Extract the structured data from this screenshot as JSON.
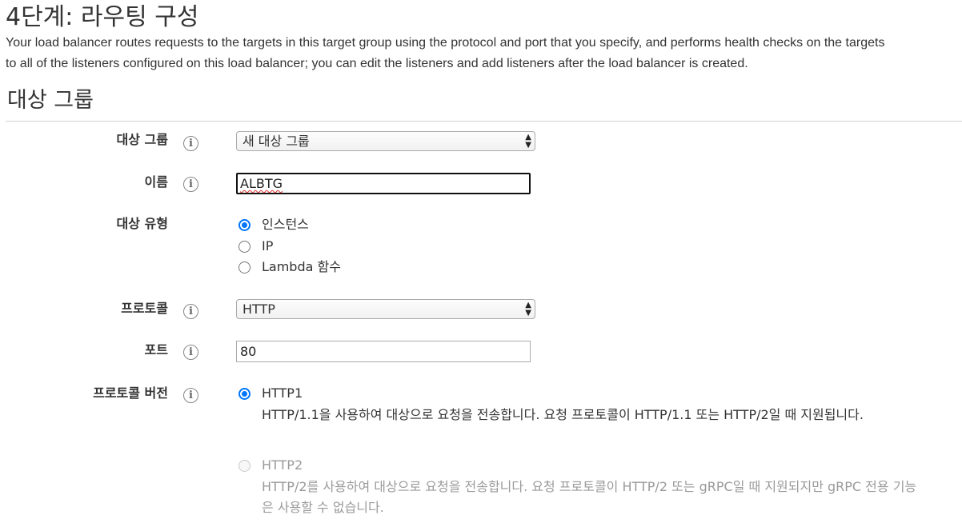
{
  "page": {
    "title": "4단계: 라우팅 구성",
    "description_line1": "Your load balancer routes requests to the targets in this target group using the protocol and port that you specify, and performs health checks on the targets",
    "description_line2": "to all of the listeners configured on this load balancer; you can edit the listeners and add listeners after the load balancer is created."
  },
  "section": {
    "title": "대상 그룹"
  },
  "form": {
    "target_group": {
      "label": "대상 그룹",
      "value": "새 대상 그룹"
    },
    "name": {
      "label": "이름",
      "value": "ALBTG"
    },
    "target_type": {
      "label": "대상 유형",
      "options": [
        {
          "label": "인스턴스",
          "checked": true
        },
        {
          "label": "IP",
          "checked": false
        },
        {
          "label": "Lambda 함수",
          "checked": false
        }
      ]
    },
    "protocol": {
      "label": "프로토콜",
      "value": "HTTP"
    },
    "port": {
      "label": "포트",
      "value": "80"
    },
    "protocol_version": {
      "label": "프로토콜 버전",
      "options": [
        {
          "label": "HTTP1",
          "checked": true,
          "enabled": true,
          "description": "HTTP/1.1을 사용하여 대상으로 요청을 전송합니다. 요청 프로토콜이 HTTP/1.1 또는 HTTP/2일 때 지원됩니다."
        },
        {
          "label": "HTTP2",
          "checked": false,
          "enabled": false,
          "description": "HTTP/2를 사용하여 대상으로 요청을 전송합니다. 요청 프로토콜이 HTTP/2 또는 gRPC일 때 지원되지만 gRPC 전용 기능은 사용할 수 없습니다."
        }
      ]
    }
  },
  "icons": {
    "info": "info-icon",
    "select_arrows": "select-arrows-icon"
  },
  "colors": {
    "radio_accent": "#0075ff",
    "spellcheck_underline": "#e03030",
    "disabled_text": "#9a9a9a"
  }
}
